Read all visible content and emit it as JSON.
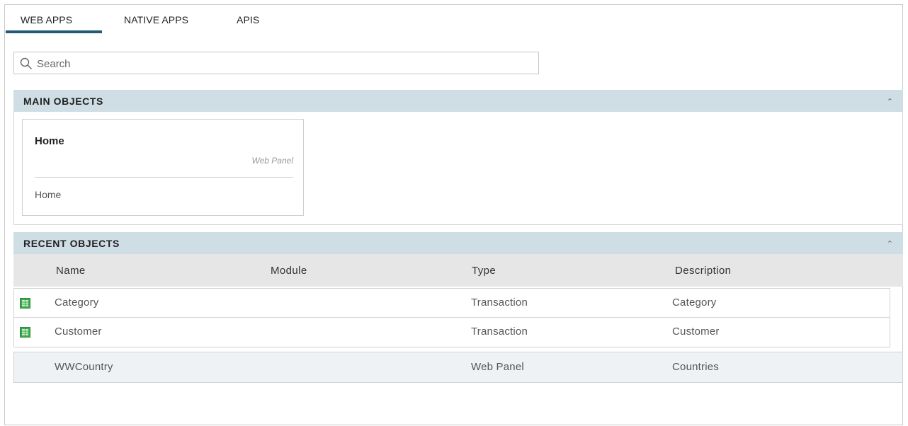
{
  "tabs": [
    {
      "label": "WEB APPS",
      "active": true
    },
    {
      "label": "NATIVE APPS",
      "active": false
    },
    {
      "label": "APIS",
      "active": false
    }
  ],
  "search": {
    "placeholder": "Search",
    "value": ""
  },
  "main_objects": {
    "title": "MAIN OBJECTS",
    "collapse_icon": "chevron-up-icon",
    "cards": [
      {
        "name": "Home",
        "type": "Web Panel",
        "description": "Home"
      }
    ]
  },
  "recent_objects": {
    "title": "RECENT OBJECTS",
    "collapse_icon": "chevron-up-icon",
    "columns": [
      "Name",
      "Module",
      "Type",
      "Description"
    ],
    "rows": [
      {
        "icon": "transaction-icon",
        "name": "Category",
        "module": "",
        "type": "Transaction",
        "description": "Category"
      },
      {
        "icon": "transaction-icon",
        "name": "Customer",
        "module": "",
        "type": "Transaction",
        "description": "Customer"
      },
      {
        "icon": "",
        "name": "WWCountry",
        "module": "",
        "type": "Web Panel",
        "description": "Countries"
      }
    ]
  },
  "colors": {
    "accent": "#1f5a78",
    "section_header_bg": "#cfdde5",
    "transaction_icon": "#3aa84a"
  }
}
